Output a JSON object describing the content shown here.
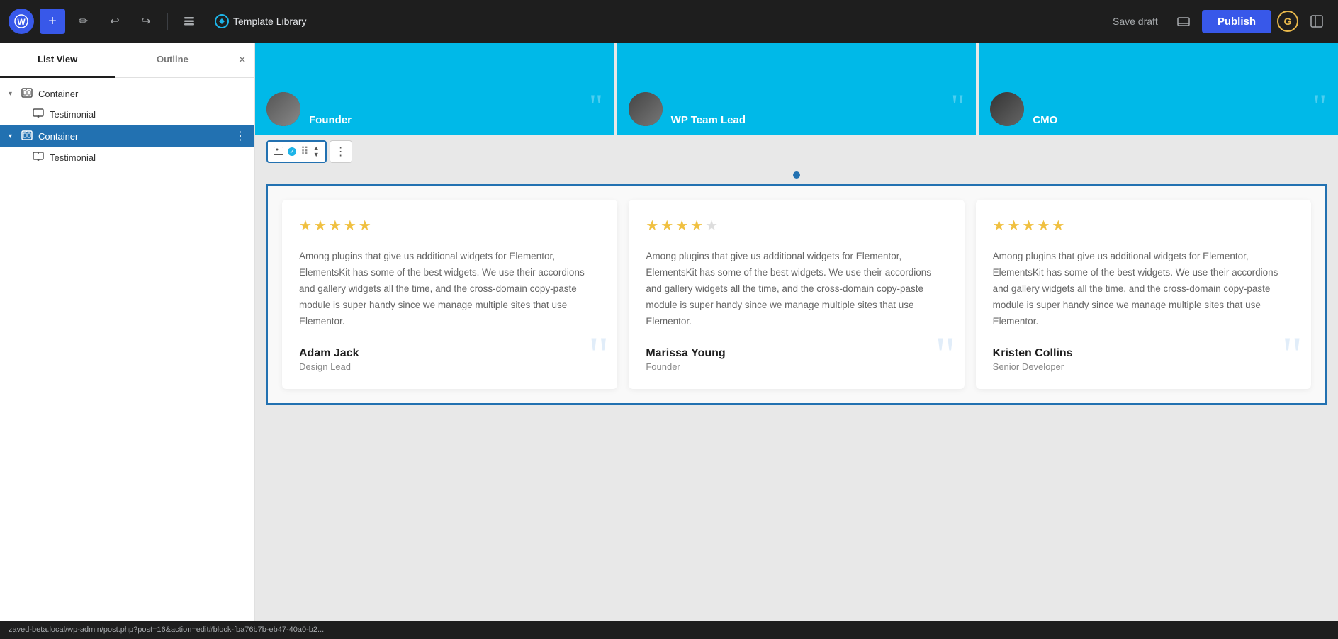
{
  "topbar": {
    "wp_logo": "W",
    "add_label": "+",
    "template_library_label": "Template Library",
    "save_draft_label": "Save draft",
    "publish_label": "Publish"
  },
  "sidebar": {
    "tab_list_view": "List View",
    "tab_outline": "Outline",
    "close_label": "×",
    "tree": [
      {
        "id": "container-1",
        "label": "Container",
        "indent": 0,
        "chevron": "▾",
        "selected": false
      },
      {
        "id": "testimonial-1",
        "label": "Testimonial",
        "indent": 1,
        "chevron": "",
        "selected": false
      },
      {
        "id": "container-2",
        "label": "Container",
        "indent": 0,
        "chevron": "▾",
        "selected": true
      },
      {
        "id": "testimonial-2",
        "label": "Testimonial",
        "indent": 1,
        "chevron": "",
        "selected": false
      }
    ]
  },
  "top_cards": [
    {
      "role": "Founder"
    },
    {
      "role": "WP Team Lead"
    },
    {
      "role": "CMO"
    }
  ],
  "testimonials": [
    {
      "stars": 5,
      "text": "Among plugins that give us additional widgets for Elementor, ElementsKit has some of the best widgets. We use their accordions and gallery widgets all the time, and the cross-domain copy-paste module is super handy since we manage multiple sites that use Elementor.",
      "author": "Adam Jack",
      "role": "Design Lead"
    },
    {
      "stars": 4,
      "text": "Among plugins that give us additional widgets for Elementor, ElementsKit has some of the best widgets. We use their accordions and gallery widgets all the time, and the cross-domain copy-paste module is super handy since we manage multiple sites that use Elementor.",
      "author": "Marissa Young",
      "role": "Founder"
    },
    {
      "stars": 5,
      "text": "Among plugins that give us additional widgets for Elementor, ElementsKit has some of the best widgets. We use their accordions and gallery widgets all the time, and the cross-domain copy-paste module is super handy since we manage multiple sites that use Elementor.",
      "author": "Kristen Collins",
      "role": "Senior Developer"
    }
  ],
  "status_bar": {
    "url": "zaved-beta.local/wp-admin/post.php?post=16&action=edit#block-fba76b7b-eb47-40a0-b2..."
  }
}
